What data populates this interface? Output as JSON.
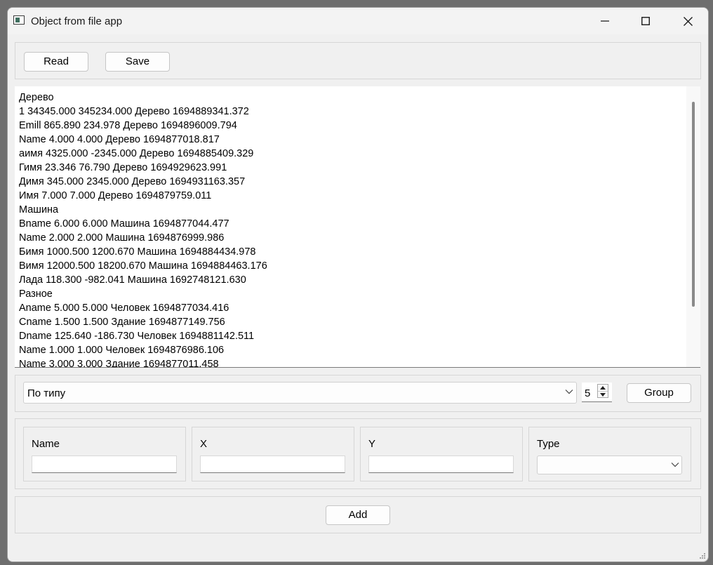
{
  "window": {
    "title": "Object from file app"
  },
  "toolbar": {
    "read_label": "Read",
    "save_label": "Save"
  },
  "text_area": {
    "lines": [
      "Дерево",
      "1 34345.000 345234.000 Дерево 1694889341.372",
      "Emill 865.890 234.978 Дерево 1694896009.794",
      "Name 4.000 4.000 Дерево 1694877018.817",
      "аимя 4325.000 -2345.000 Дерево 1694885409.329",
      "Гимя 23.346 76.790 Дерево 1694929623.991",
      "Димя 345.000 2345.000 Дерево 1694931163.357",
      "Имя 7.000 7.000 Дерево 1694879759.011",
      "Машина",
      "Bname 6.000 6.000 Машина 1694877044.477",
      "Name 2.000 2.000 Машина 1694876999.986",
      "Бимя 1000.500 1200.670 Машина 1694884434.978",
      "Вимя 12000.500 18200.670 Машина 1694884463.176",
      "Лада 118.300 -982.041 Машина 1692748121.630",
      "Разное",
      "Aname 5.000 5.000 Человек 1694877034.416",
      "Cname 1.500 1.500 Здание 1694877149.756",
      "Dname 125.640 -186.730 Человек 1694881142.511",
      "Name 1.000 1.000 Человек 1694876986.106",
      "Name 3.000 3.000 Здание 1694877011.458"
    ]
  },
  "grouping": {
    "sort_selected": "По типу",
    "count_value": "5",
    "group_label": "Group"
  },
  "form": {
    "name_label": "Name",
    "x_label": "X",
    "y_label": "Y",
    "type_label": "Type",
    "name_value": "",
    "x_value": "",
    "y_value": "",
    "type_selected": "",
    "add_label": "Add"
  }
}
